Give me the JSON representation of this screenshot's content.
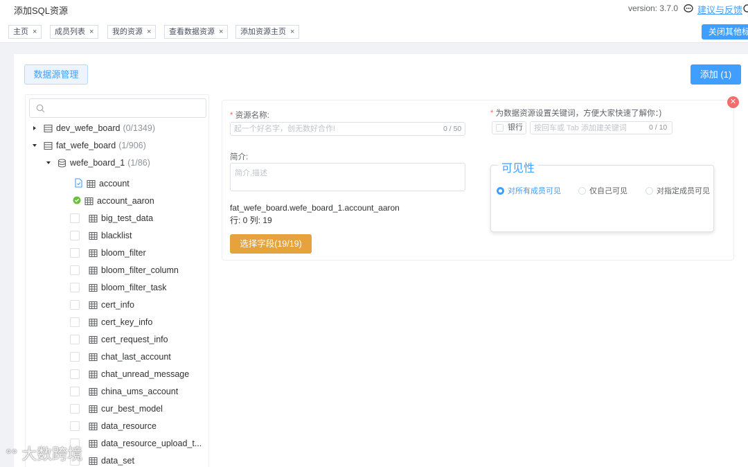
{
  "header": {
    "title": "添加SQL资源",
    "version": "version: 3.7.0",
    "feedback": "建议与反馈"
  },
  "tags": [
    {
      "label": "主页",
      "close": "×"
    },
    {
      "label": "成员列表",
      "close": "×"
    },
    {
      "label": "我的资源",
      "close": "×"
    },
    {
      "label": "查看数据资源",
      "close": "×"
    },
    {
      "label": "添加资源主页",
      "close": "×"
    }
  ],
  "close_others": "关闭其他标签",
  "toolbar": {
    "datasource_label": "数据源管理",
    "add_label": "添加 (1)"
  },
  "tree": {
    "search_placeholder": "",
    "nodes": [
      {
        "label": "dev_wefe_board",
        "count": "(0/1349)"
      },
      {
        "label": "fat_wefe_board",
        "count": "(1/906)"
      },
      {
        "label": "wefe_board_1",
        "count": "(1/86)"
      }
    ],
    "tables": [
      "account",
      "account_aaron",
      "big_test_data",
      "blacklist",
      "bloom_filter",
      "bloom_filter_column",
      "bloom_filter_task",
      "cert_info",
      "cert_key_info",
      "cert_request_info",
      "chat_last_account",
      "chat_unread_message",
      "china_ums_account",
      "cur_best_model",
      "data_resource",
      "data_resource_upload_t...",
      "data_set"
    ]
  },
  "form": {
    "name_label": "资源名称:",
    "name_placeholder": "起一个好名字，创无数好合作!",
    "name_counter": "0 / 50",
    "intro_label": "简介:",
    "intro_placeholder": "简介,描述",
    "path": "fat_wefe_board.wefe_board_1.account_aaron",
    "rows_cols": "行: 0 列: 19",
    "select_fields": "选择字段(19/19)",
    "keyword_label": "为数据资源设置关键词，方便大家快速了解你：)",
    "keyword_tag": "银行",
    "keyword_placeholder": "按回车或 Tab 添加建关键词",
    "keyword_counter": "0 / 10",
    "visibility_title": "可见性",
    "visibility_options": [
      "对所有成员可见",
      "仅自己可见",
      "对指定成员可见"
    ]
  },
  "watermark": "大数跨境",
  "colors": {
    "primary": "#409eff",
    "warning": "#e6a23c",
    "danger": "#f56c6c",
    "success": "#67c23a"
  }
}
